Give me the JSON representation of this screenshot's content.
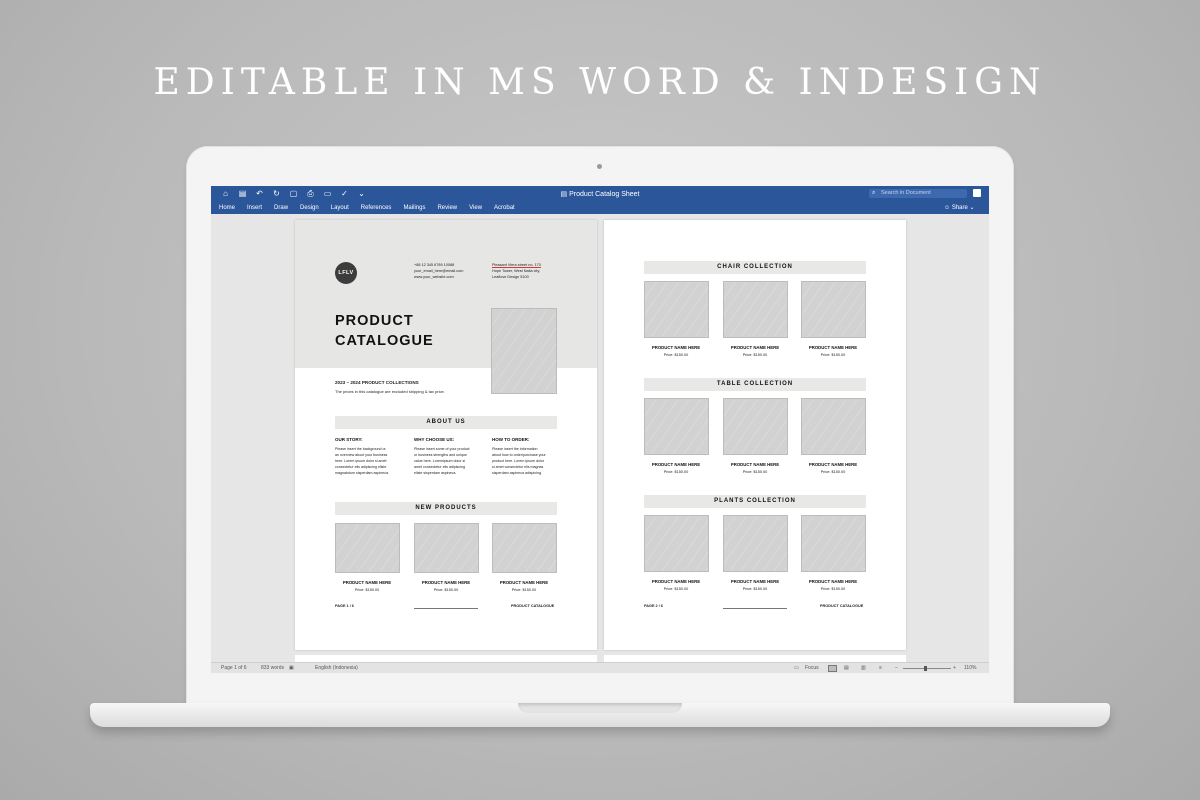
{
  "headline": "EDITABLE IN MS WORD & INDESIGN",
  "app": {
    "doc_title": "Product Catalog Sheet",
    "search_placeholder": "Search in Document",
    "share_label": "Share",
    "ribbon": [
      "Home",
      "Insert",
      "Draw",
      "Design",
      "Layout",
      "References",
      "Mailings",
      "Review",
      "View",
      "Acrobat"
    ],
    "accent_color": "#2b579a"
  },
  "status": {
    "page": "Page 1 of 6",
    "words": "833 words",
    "language": "English (Indonesia)",
    "focus": "Focus",
    "zoom_minus": "−",
    "zoom_plus": "+",
    "zoom": "110%"
  },
  "page1": {
    "logo": "LFLV",
    "contact_phone": "+88 12 345 6789 10088",
    "contact_email": "your_email_here@email.com",
    "contact_web": "www.your_website.com",
    "address_1": "Pleasant Viera street no. 170",
    "address_2": "Hope Tower, West Natla city,",
    "address_3": "Leaflove Design 5100",
    "title_1": "PRODUCT",
    "title_2": "CATALOGUE",
    "collections": "2023 – 2024 PRODUCT COLLECTIONS",
    "collections_note": "The prices in this catalogue are excluded shipping & tax price.",
    "about_title": "ABOUT US",
    "columns": [
      {
        "heading": "OUR STORY:",
        "lines": [
          "Please insert the background or",
          "an overview about your business",
          "here. Lorem ipsum dolor si amet",
          "consectetur elis adipiscing eliste",
          "magnabdum sisperdam aspineca."
        ]
      },
      {
        "heading": "WHY CHOOSE US:",
        "lines": [
          "Please insert some of your product",
          "or business strengths and unique",
          "value here. Loremipsum dolor si",
          "amet consectetur elis adipiscing",
          "eliste sisperdam aspineca."
        ]
      },
      {
        "heading": "HOW TO ORDER:",
        "lines": [
          "Please insert the information",
          "about how to order/purchase your",
          "product here. Lorem ipsum dolor",
          "si amet consectetur elis magnas",
          "sisperdam aspineca adispicing."
        ]
      }
    ],
    "new_products_title": "NEW PRODUCTS",
    "products": [
      {
        "name": "PRODUCT NAME HERE",
        "price": "Price:  $150.00"
      },
      {
        "name": "PRODUCT NAME HERE",
        "price": "Price:  $150.00"
      },
      {
        "name": "PRODUCT NAME HERE",
        "price": "Price:  $150.00"
      }
    ],
    "footer_page": "PAGE 1 / 6",
    "footer_title": "PRODUCT CATALOGUE"
  },
  "page2": {
    "sections": [
      {
        "title": "CHAIR COLLECTION",
        "products": [
          {
            "name": "PRODUCT NAME HERE",
            "price": "Price:  $150.00"
          },
          {
            "name": "PRODUCT NAME HERE",
            "price": "Price:  $150.00"
          },
          {
            "name": "PRODUCT NAME HERE",
            "price": "Price:  $150.00"
          }
        ]
      },
      {
        "title": "TABLE COLLECTION",
        "products": [
          {
            "name": "PRODUCT NAME HERE",
            "price": "Price:  $150.00"
          },
          {
            "name": "PRODUCT NAME HERE",
            "price": "Price:  $150.00"
          },
          {
            "name": "PRODUCT NAME HERE",
            "price": "Price:  $150.00"
          }
        ]
      },
      {
        "title": "PLANTS COLLECTION",
        "products": [
          {
            "name": "PRODUCT NAME HERE",
            "price": "Price:  $150.00"
          },
          {
            "name": "PRODUCT NAME HERE",
            "price": "Price:  $150.00"
          },
          {
            "name": "PRODUCT NAME HERE",
            "price": "Price:  $150.00"
          }
        ]
      }
    ],
    "footer_page": "PAGE 2 / 6",
    "footer_title": "PRODUCT CATALOGUE"
  }
}
